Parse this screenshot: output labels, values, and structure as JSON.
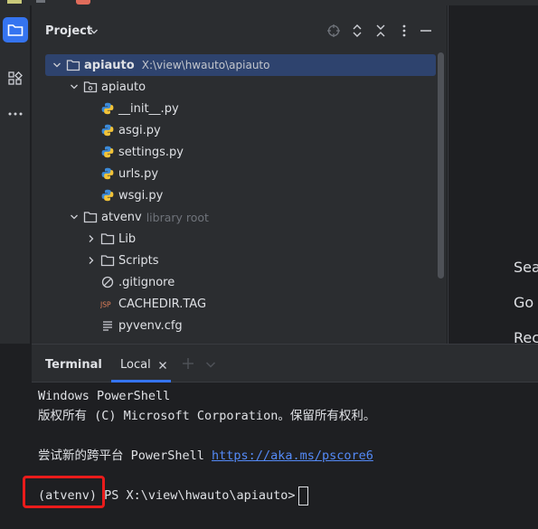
{
  "project_panel": {
    "title": "Project",
    "tree": [
      {
        "label": "apiauto",
        "path": "X:\\view\\hwauto\\apiauto",
        "indent": 0,
        "chevron": "down",
        "icon": "folder-icon",
        "selected": true,
        "bold": true
      },
      {
        "label": "apiauto",
        "indent": 1,
        "chevron": "down",
        "icon": "package-icon"
      },
      {
        "label": "__init__.py",
        "indent": 2,
        "icon": "python-icon"
      },
      {
        "label": "asgi.py",
        "indent": 2,
        "icon": "python-icon"
      },
      {
        "label": "settings.py",
        "indent": 2,
        "icon": "python-icon"
      },
      {
        "label": "urls.py",
        "indent": 2,
        "icon": "python-icon"
      },
      {
        "label": "wsgi.py",
        "indent": 2,
        "icon": "python-icon"
      },
      {
        "label": "atvenv",
        "hint": "library root",
        "indent": 1,
        "chevron": "down",
        "icon": "folder-icon"
      },
      {
        "label": "Lib",
        "indent": 2,
        "chevron": "right",
        "icon": "folder-icon"
      },
      {
        "label": "Scripts",
        "indent": 2,
        "chevron": "right",
        "icon": "folder-icon"
      },
      {
        "label": ".gitignore",
        "indent": 2,
        "icon": "ignore-file-icon"
      },
      {
        "label": "CACHEDIR.TAG",
        "indent": 2,
        "icon": "jsp-file-icon"
      },
      {
        "label": "pyvenv.cfg",
        "indent": 2,
        "icon": "text-file-icon"
      }
    ]
  },
  "editor_hints": [
    "Sea",
    "Go t",
    "Rec"
  ],
  "terminal": {
    "title": "Terminal",
    "tab_label": "Local",
    "lines": {
      "line1": "Windows PowerShell",
      "line2": "版权所有 (C) Microsoft Corporation。保留所有权利。",
      "line3_prefix": "尝试新的跨平台 PowerShell ",
      "line3_link": "https://aka.ms/pscore6",
      "prompt_env": "(atvenv)",
      "prompt_path": " PS X:\\view\\hwauto\\apiauto>"
    }
  },
  "colors": {
    "accent": "#3574f0",
    "selection": "#2e436e",
    "link": "#548af7",
    "highlight_box": "#ea1b1b"
  }
}
